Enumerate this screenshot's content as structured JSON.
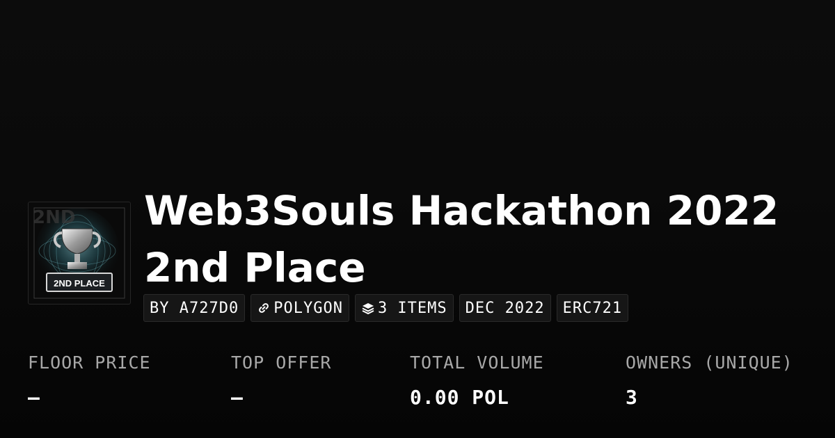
{
  "collection": {
    "title": "Web3Souls Hackathon 2022 2nd Place",
    "image_text": "2ND PLACE",
    "image_watermark": "2ND"
  },
  "tags": [
    {
      "label": "BY A727D0",
      "icon": ""
    },
    {
      "label": "POLYGON",
      "icon": "link-icon"
    },
    {
      "label": "3 ITEMS",
      "icon": "layers-icon"
    },
    {
      "label": "DEC 2022",
      "icon": ""
    },
    {
      "label": "ERC721",
      "icon": ""
    }
  ],
  "stats": [
    {
      "label": "FLOOR PRICE",
      "value": "–"
    },
    {
      "label": "TOP OFFER",
      "value": "–"
    },
    {
      "label": "TOTAL VOLUME",
      "value": "0.00 POL"
    },
    {
      "label": "OWNERS (UNIQUE)",
      "value": "3"
    }
  ],
  "colors": {
    "background": "#0a0a0a",
    "text": "#ffffff",
    "muted": "#a8a8a8",
    "tag_background": "#161616"
  }
}
